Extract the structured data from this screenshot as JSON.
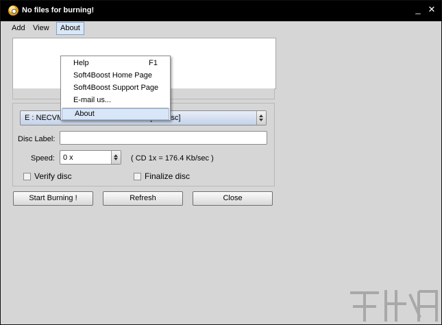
{
  "window": {
    "title": "No files for burning!",
    "minimize_glyph": "_",
    "close_glyph": "✕"
  },
  "menubar": {
    "add": "Add",
    "view": "View",
    "about": "About"
  },
  "about_menu": {
    "help": "Help",
    "help_shortcut": "F1",
    "home_page": "Soft4Boost Home Page",
    "support_page": "Soft4Boost Support Page",
    "email": "E-mail us...",
    "about": "About"
  },
  "drive": {
    "selected": "E : NECVMWar VMware IDE CDR10    [No Disc]"
  },
  "disc_label": {
    "label": "Disc Label:",
    "value": ""
  },
  "speed": {
    "label": "Speed:",
    "selected": "0 x",
    "info": "( CD 1x = 176.4 Kb/sec )"
  },
  "options": {
    "verify_label": "Verify disc",
    "verify_checked": false,
    "finalize_label": "Finalize disc",
    "finalize_checked": false
  },
  "buttons": {
    "start": "Start Burning !",
    "refresh": "Refresh",
    "close": "Close"
  },
  "icons": {
    "app": "disc-face-icon",
    "watermark": "watermark-logo"
  }
}
